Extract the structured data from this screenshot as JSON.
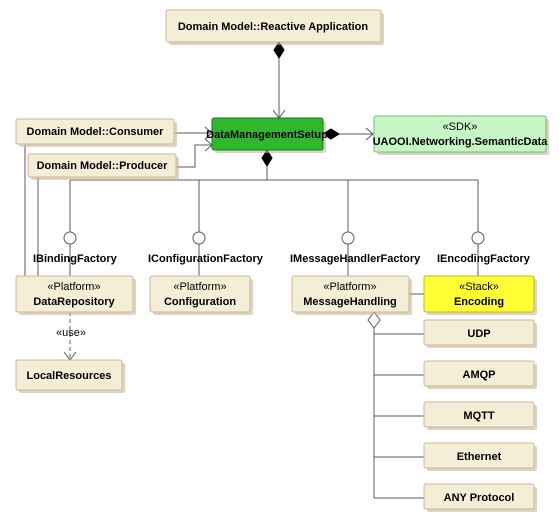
{
  "top": {
    "label": "Domain Model::Reactive Application"
  },
  "consumer": {
    "label": "Domain Model::Consumer"
  },
  "producer": {
    "label": "Domain Model::Producer"
  },
  "setup": {
    "label": "DataManagementSetup"
  },
  "sdk": {
    "stereo": "«SDK»",
    "label": "UAOOI.Networking.SemanticData"
  },
  "ifaces": {
    "binding": "IBindingFactory",
    "config": "IConfigurationFactory",
    "msg": "IMessageHandlerFactory",
    "enc": "IEncodingFactory"
  },
  "repo": {
    "stereo": "«Platform»",
    "label": "DataRepository"
  },
  "config": {
    "stereo": "«Platform»",
    "label": "Configuration"
  },
  "msgh": {
    "stereo": "«Platform»",
    "label": "MessageHandling"
  },
  "encoding": {
    "stereo": "«Stack»",
    "label": "Encoding"
  },
  "use": "«use»",
  "local": {
    "label": "LocalResources"
  },
  "proto": {
    "udp": "UDP",
    "amqp": "AMQP",
    "mqtt": "MQTT",
    "eth": "Ethernet",
    "any": "ANY Protocol"
  }
}
